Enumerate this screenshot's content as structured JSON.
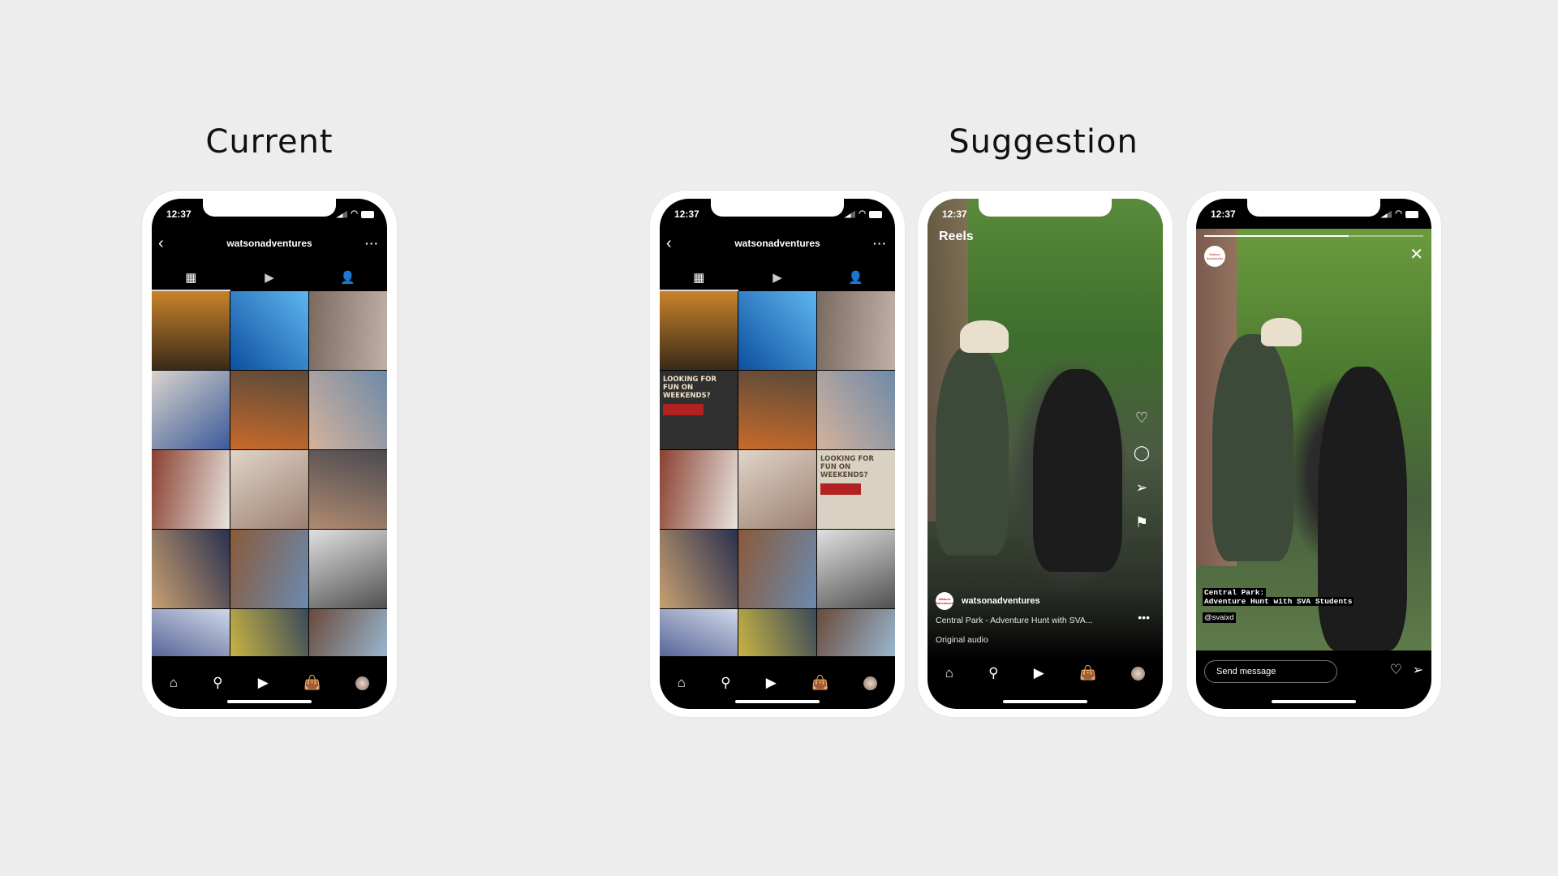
{
  "headings": {
    "current": "Current",
    "suggestion": "Suggestion"
  },
  "status": {
    "time": "12:37"
  },
  "profile": {
    "username": "watsonadventures",
    "back": "‹",
    "more": "···",
    "tabs": [
      "▦",
      "▶",
      "👤"
    ]
  },
  "nav": [
    "⌂",
    "⚲",
    "▶",
    "👜"
  ],
  "poster": {
    "text": "LOOKING FOR FUN ON WEEKENDS?"
  },
  "current_posts": [
    [
      "#3a2a18",
      "#c9832a"
    ],
    [
      "#0c4f9e",
      "#5fb6f0"
    ],
    [
      "#7a6a60",
      "#c0b0a6"
    ],
    [
      "#d9d4cc",
      "#3a5a9a"
    ],
    [
      "#5a4a3a",
      "#c86a2a"
    ],
    [
      "#6e8aa8",
      "#d4b29c"
    ],
    [
      "#e8e4df",
      "#8a4030"
    ],
    [
      "#9c8070",
      "#e0d4c8"
    ],
    [
      "#b08a70",
      "#4a4a50"
    ],
    [
      "#c8a070",
      "#2a3050"
    ],
    [
      "#8a5a3a",
      "#6a8ab0"
    ],
    [
      "#e0e0e0",
      "#505050"
    ],
    [
      "#d0d8e8",
      "#2a3a7a"
    ],
    [
      "#3a4a5a",
      "#d8c040"
    ],
    [
      "#a0c8e8",
      "#6a4a3a"
    ]
  ],
  "suggestion_posts": [
    [
      "#3a2a18",
      "#c9832a"
    ],
    [
      "#0c4f9e",
      "#5fb6f0"
    ],
    [
      "#7a6a60",
      "#c0b0a6"
    ],
    "poster",
    [
      "#5a4a3a",
      "#c86a2a"
    ],
    [
      "#6e8aa8",
      "#d4b29c"
    ],
    [
      "#e8e4df",
      "#8a4030"
    ],
    [
      "#9c8070",
      "#e0d4c8"
    ],
    "poster-light",
    [
      "#c8a070",
      "#2a3050"
    ],
    [
      "#8a5a3a",
      "#6a8ab0"
    ],
    [
      "#e0e0e0",
      "#505050"
    ],
    [
      "#d0d8e8",
      "#2a3a7a"
    ],
    [
      "#3a4a5a",
      "#d8c040"
    ],
    [
      "#a0c8e8",
      "#6a4a3a"
    ]
  ],
  "reel": {
    "label": "Reels",
    "username": "watsonadventures",
    "caption": "Central Park - Adventure Hunt with SVA...",
    "audio": "Original audio",
    "more": "•••",
    "actions": [
      "♡",
      "◯",
      "➢",
      "⚑"
    ]
  },
  "story": {
    "progress": 0.66,
    "close": "✕",
    "caption_line1": "Central Park:",
    "caption_line2": "Adventure Hunt with SVA Students",
    "mention": "@svaixd",
    "message_placeholder": "Send message",
    "heart": "♡",
    "send": "➢"
  },
  "logo_text": "Watson Adventures"
}
